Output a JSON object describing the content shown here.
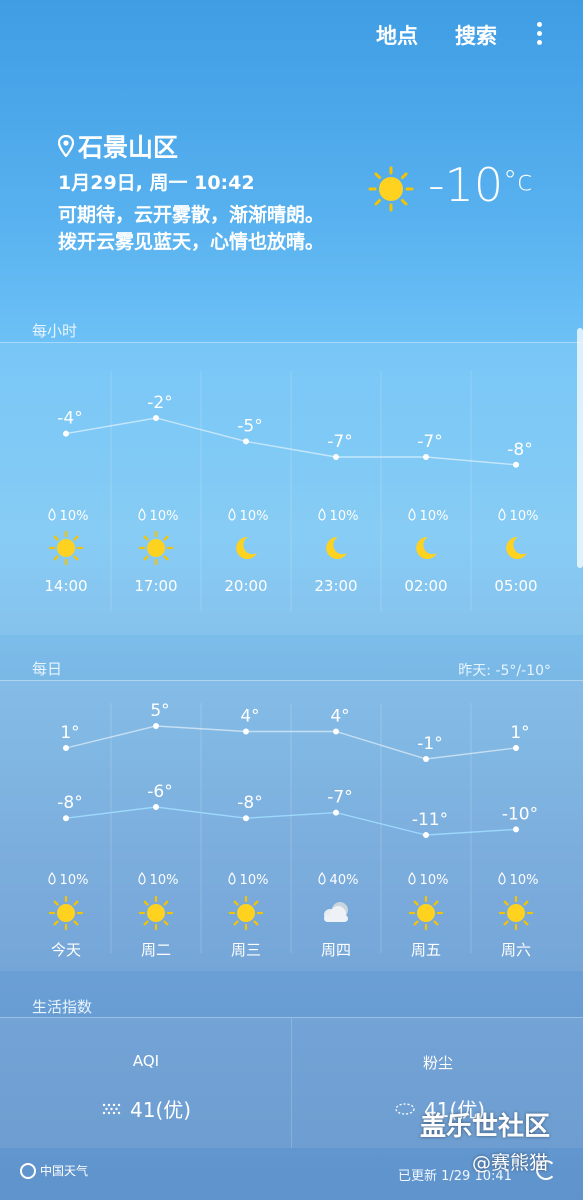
{
  "topbar": {
    "location_label": "地点",
    "search_label": "搜索"
  },
  "current": {
    "location": "石景山区",
    "datetime": "1月29日, 周一 10:42",
    "desc_line1": "可期待，云开雾散，渐渐晴朗。",
    "desc_line2": "拨开云雾见蓝天，心情也放晴。",
    "temp": "-10",
    "unit": "°c",
    "icon": "sun-icon"
  },
  "hourly": {
    "label": "每小时",
    "items": [
      {
        "time": "14:00",
        "temp": "-4°",
        "value": -4,
        "precip": "10%",
        "icon": "sun-icon"
      },
      {
        "time": "17:00",
        "temp": "-2°",
        "value": -2,
        "precip": "10%",
        "icon": "sun-icon"
      },
      {
        "time": "20:00",
        "temp": "-5°",
        "value": -5,
        "precip": "10%",
        "icon": "moon-icon"
      },
      {
        "time": "23:00",
        "temp": "-7°",
        "value": -7,
        "precip": "10%",
        "icon": "moon-icon"
      },
      {
        "time": "02:00",
        "temp": "-7°",
        "value": -7,
        "precip": "10%",
        "icon": "moon-icon"
      },
      {
        "time": "05:00",
        "temp": "-8°",
        "value": -8,
        "precip": "10%",
        "icon": "moon-icon"
      }
    ]
  },
  "daily": {
    "label": "每日",
    "yesterday": "昨天: -5°/-10°",
    "items": [
      {
        "day": "今天",
        "high": "1°",
        "low": "-8°",
        "high_v": 1,
        "low_v": -8,
        "precip": "10%",
        "icon": "sun-icon"
      },
      {
        "day": "周二",
        "high": "5°",
        "low": "-6°",
        "high_v": 5,
        "low_v": -6,
        "precip": "10%",
        "icon": "sun-icon"
      },
      {
        "day": "周三",
        "high": "4°",
        "low": "-8°",
        "high_v": 4,
        "low_v": -8,
        "precip": "10%",
        "icon": "sun-icon"
      },
      {
        "day": "周四",
        "high": "4°",
        "low": "-7°",
        "high_v": 4,
        "low_v": -7,
        "precip": "40%",
        "icon": "cloud-icon"
      },
      {
        "day": "周五",
        "high": "-1°",
        "low": "-11°",
        "high_v": -1,
        "low_v": -11,
        "precip": "10%",
        "icon": "sun-icon"
      },
      {
        "day": "周六",
        "high": "1°",
        "low": "-10°",
        "high_v": 1,
        "low_v": -10,
        "precip": "10%",
        "icon": "sun-icon"
      }
    ]
  },
  "life": {
    "label": "生活指数",
    "aqi_title": "AQI",
    "aqi_value": "41(优)",
    "dust_title": "粉尘",
    "dust_value": "41(优)"
  },
  "footer": {
    "logo_text": "中国天气",
    "updated": "已更新 1/29 10:41",
    "watermark": "盖乐世社区",
    "watermark2": "@赛熊猫"
  },
  "colors": {
    "sun": "#ffd21f",
    "sun_ray": "#f5c400"
  }
}
